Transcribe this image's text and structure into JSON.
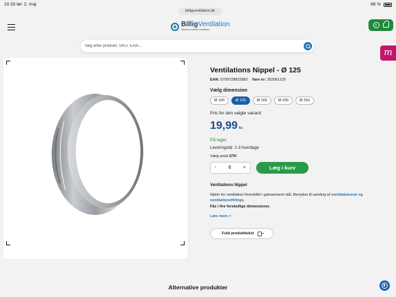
{
  "status_bar": {
    "time": "10.33",
    "date": "lør. 2. maj",
    "battery": "88 %"
  },
  "browser": {
    "url": "billigventilation.dk"
  },
  "header": {
    "logo_main": "Billig",
    "logo_accent": "Ventilation",
    "logo_tagline": "Nordens laveste indeklima",
    "cart_count": "0"
  },
  "search": {
    "placeholder": "Søg efter produkt, SKU, EAN..."
  },
  "side_badge": "m",
  "product": {
    "title": "Ventilations Nippel - Ø 125",
    "ean_label": "EAN:",
    "ean_value": "5709728822882",
    "sku_label": "Vare nr:",
    "sku_value": "352061125",
    "dimension_label": "Vælg dimension",
    "dimensions": [
      "Ø 100",
      "Ø 125",
      "Ø 160",
      "Ø 200",
      "Ø 250"
    ],
    "selected_dimension": "Ø 125",
    "price_label": "Pris for den valgte variant:",
    "price_value": "19,99",
    "price_unit": "kr.",
    "stock": "På lager",
    "lead_time": "Leveringstid: 1-3 hverdage",
    "qty_label": "Vælg antal",
    "qty_unit": "STK",
    "qty_minus": "-",
    "qty_value": "6",
    "qty_plus": "+",
    "add_to_cart": "Læg i kurv",
    "description_title": "Ventilations Nippel",
    "description_pre": "Nipler for ventilation fremstillet i galvaniseret stål. Benyttes til samling af ",
    "description_link1": "ventilationsrør",
    "description_mid": " og ",
    "description_link2": "ventilationsfittings",
    "description_post": ".",
    "description_bold": "Fås i fire forskellige dimensioner.",
    "read_more": "Læs mere >",
    "full_text_button": "Fuld produkttekst"
  },
  "alternatives_title": "Alternative produkter",
  "colors": {
    "brand_blue": "#1b75bb",
    "price_blue": "#1b4f8c",
    "green": "#2a9a49",
    "magenta": "#c3156e"
  }
}
